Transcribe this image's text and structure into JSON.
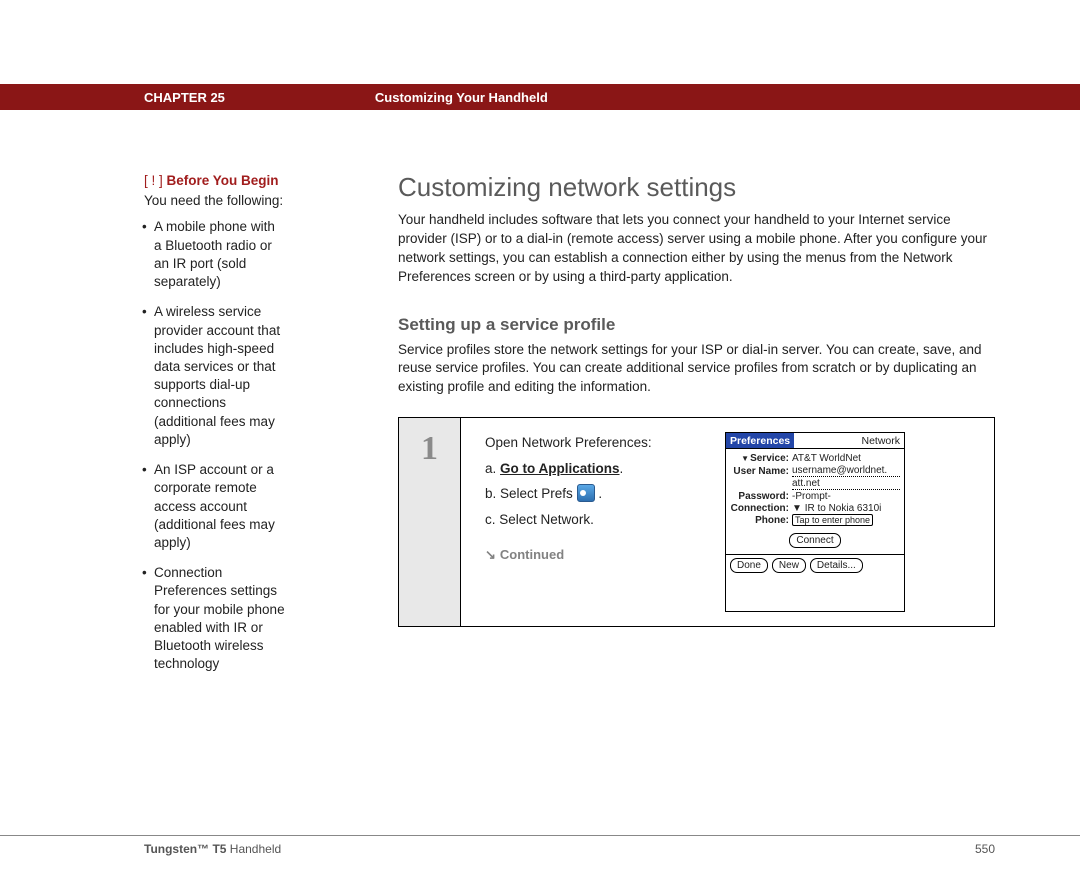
{
  "header": {
    "chapter": "CHAPTER 25",
    "title": "Customizing Your Handheld"
  },
  "sidebar": {
    "byb_label": "Before You Begin",
    "brackets_open": "[ ! ]",
    "intro": "You need the following:",
    "items": [
      "A mobile phone with a Bluetooth radio or an IR port (sold separately)",
      "A wireless service provider account that includes high-speed data services or that supports dial-up connections (additional fees may apply)",
      "An ISP account or a corporate remote access account (additional fees may apply)",
      "Connection Preferences settings for your mobile phone enabled with IR or Bluetooth wireless technology"
    ]
  },
  "main": {
    "h1": "Customizing network settings",
    "intro": "Your handheld includes software that lets you connect your handheld to your Internet service provider (ISP) or to a dial-in (remote access) server using a mobile phone. After you configure your network settings, you can establish a connection either by using the menus from the Network Preferences screen or by using a third-party application.",
    "h2": "Setting up a service profile",
    "subintro": "Service profiles store the network settings for your ISP or dial-in server. You can create, save, and reuse service profiles. You can create additional service profiles from scratch or by duplicating an existing profile and editing the information.",
    "step": {
      "num": "1",
      "lead": "Open Network Preferences:",
      "a_prefix": "a.",
      "a_link": "Go to Applications",
      "a_suffix": ".",
      "b_prefix": "b.",
      "b_text": "Select Prefs",
      "b_suffix": ".",
      "c_prefix": "c.",
      "c_text": "Select Network.",
      "continued": "Continued"
    }
  },
  "palm": {
    "title_left": "Preferences",
    "title_right": "Network",
    "rows": {
      "service_lbl": "Service:",
      "service_val": "AT&T WorldNet",
      "user_lbl": "User Name:",
      "user_val1": "username@worldnet.",
      "user_val2": "att.net",
      "password_lbl": "Password:",
      "password_val": "-Prompt-",
      "connection_lbl": "Connection:",
      "connection_val": "IR to Nokia 6310i",
      "phone_lbl": "Phone:",
      "phone_val": "Tap to enter phone"
    },
    "connect_btn": "Connect",
    "footer": {
      "done": "Done",
      "new": "New",
      "details": "Details..."
    }
  },
  "footer": {
    "product_bold": "Tungsten™ T5",
    "product_rest": " Handheld",
    "page": "550"
  }
}
